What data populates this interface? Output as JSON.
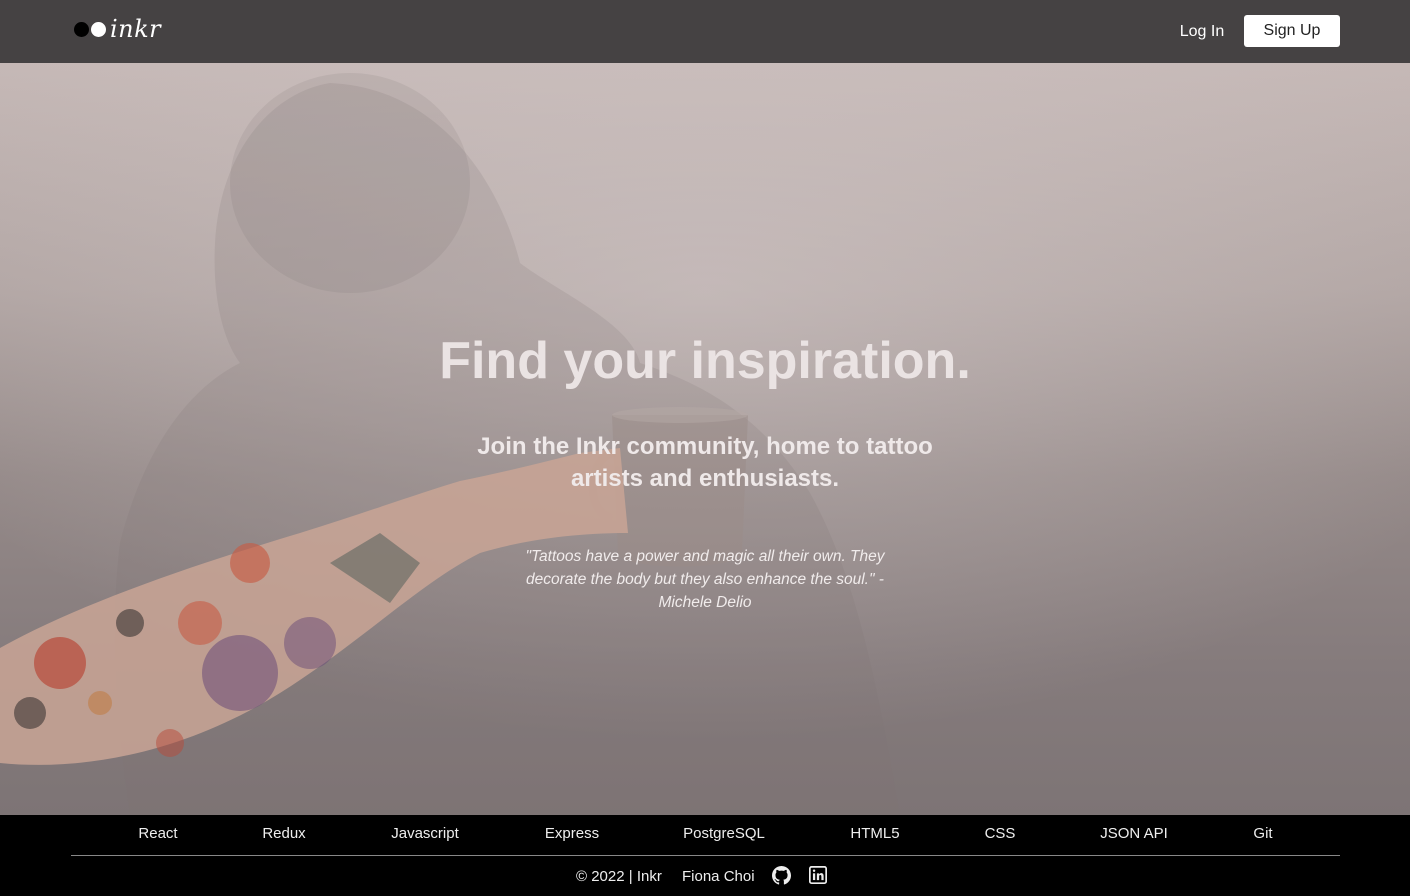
{
  "nav": {
    "logo_text": "inkr",
    "login_label": "Log In",
    "signup_label": "Sign Up"
  },
  "hero": {
    "headline": "Find your inspiration.",
    "subhead": "Join the Inkr community, home to tattoo artists and enthusiasts.",
    "quote": "\"Tattoos have a power and magic all their own. They decorate the body but they also enhance the soul.\" - Michele Delio"
  },
  "footer": {
    "tech": [
      "React",
      "Redux",
      "Javascript",
      "Express",
      "PostgreSQL",
      "HTML5",
      "CSS",
      "JSON API",
      "Git"
    ],
    "copyright": "© 2022 | Inkr",
    "author": "Fiona Choi",
    "icons": [
      "github-icon",
      "linkedin-icon"
    ]
  },
  "colors": {
    "nav_bg": "#454243",
    "footer_bg": "#000000",
    "signup_bg": "#ffffff"
  }
}
